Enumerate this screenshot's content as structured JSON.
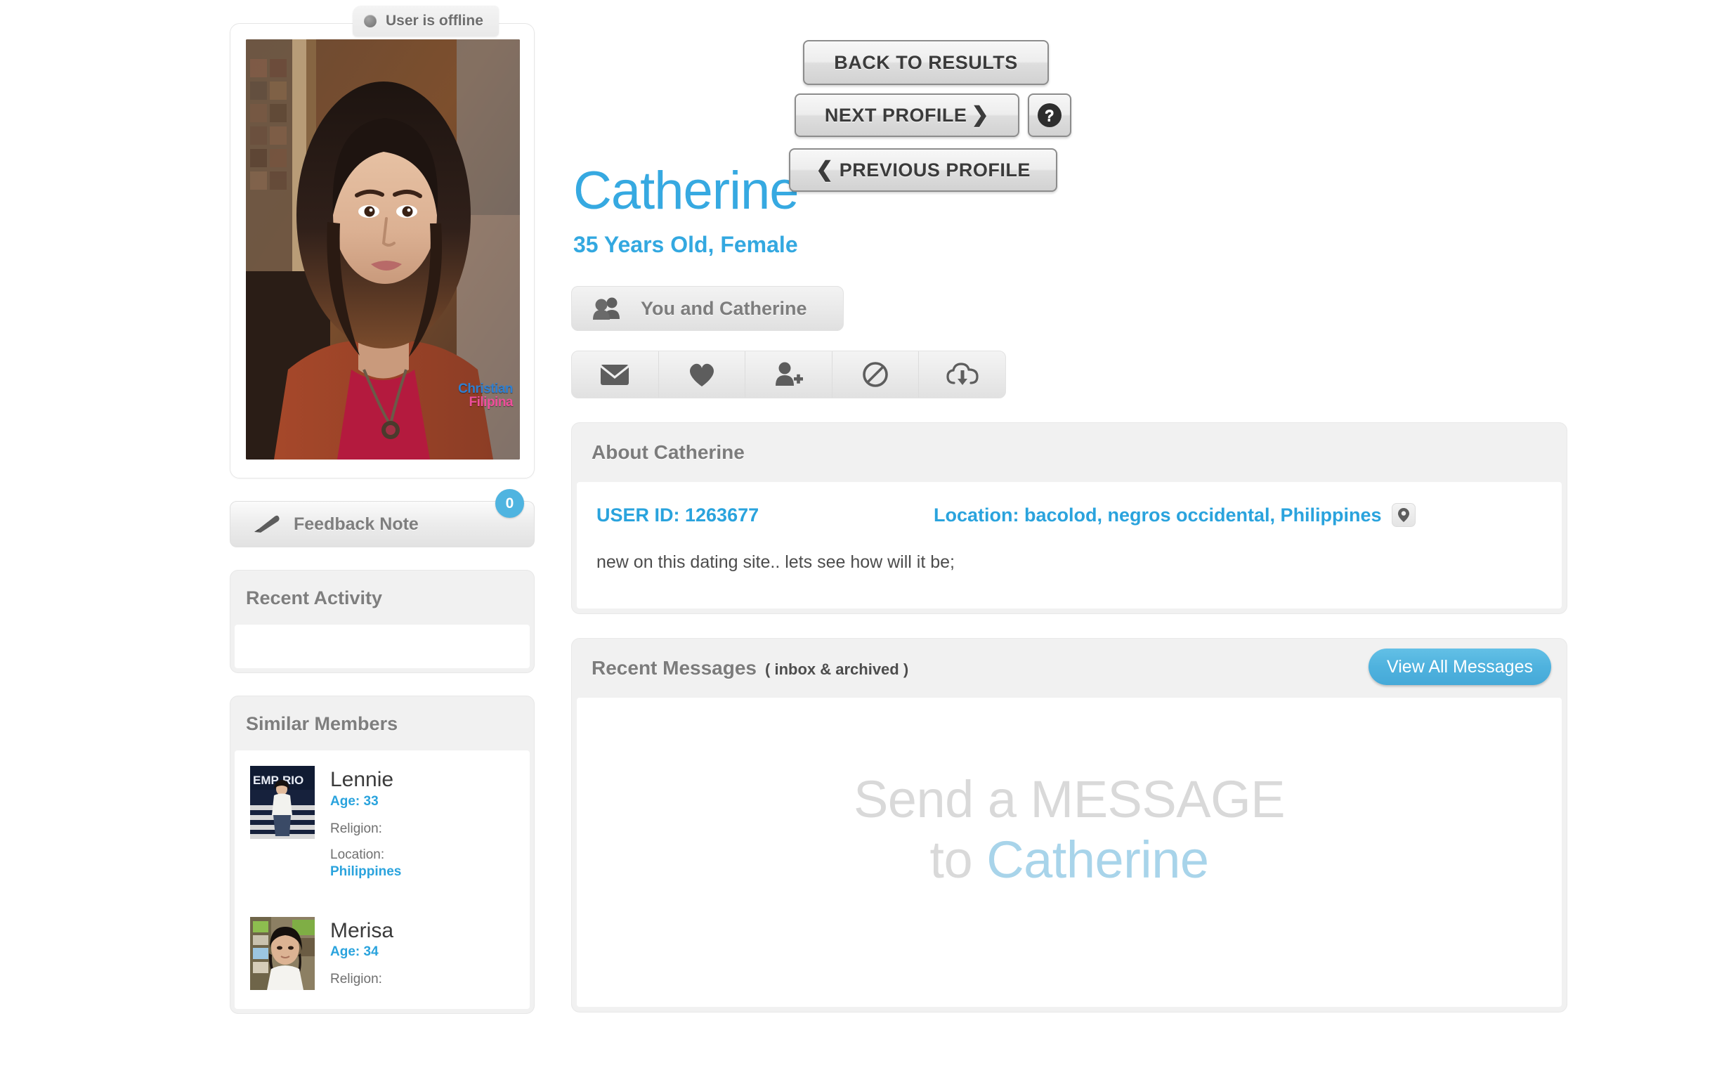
{
  "profile": {
    "status_text": "User is offline",
    "status_icon": "offline-dot-icon",
    "photo_watermark_line1": "Christian",
    "photo_watermark_line2": "Filipina",
    "name": "Catherine",
    "subtitle": "35 Years Old, Female",
    "you_and_label": "You and Catherine"
  },
  "nav": {
    "back_to_results": "BACK TO RESULTS",
    "next_profile": "NEXT PROFILE",
    "next_chevron": "❯",
    "previous_profile": "PREVIOUS PROFILE",
    "previous_chevron": "❮",
    "help": "?"
  },
  "actions": [
    {
      "name": "send-message",
      "icon": "envelope-icon"
    },
    {
      "name": "add-favorite",
      "icon": "heart-icon"
    },
    {
      "name": "add-friend",
      "icon": "person-add-icon"
    },
    {
      "name": "block-user",
      "icon": "block-icon"
    },
    {
      "name": "download-photos",
      "icon": "cloud-download-icon"
    }
  ],
  "sidebar": {
    "feedback_note": {
      "label": "Feedback Note",
      "badge": "0",
      "icon": "pen-icon"
    },
    "recent_activity": {
      "title": "Recent Activity",
      "items": []
    },
    "similar_members": {
      "title": "Similar Members",
      "members": [
        {
          "name": "Lennie",
          "age_label": "Age: 33",
          "religion_label": "Religion:",
          "religion_value": "",
          "location_label": "Location:",
          "location_value": "Philippines"
        },
        {
          "name": "Merisa",
          "age_label": "Age: 34",
          "religion_label": "Religion:",
          "religion_value": "",
          "location_label": "",
          "location_value": ""
        }
      ]
    }
  },
  "about": {
    "title": "About Catherine",
    "user_id": "USER ID: 1263677",
    "location": "Location: bacolod, negros occidental, Philippines",
    "map_icon": "map-pin-icon",
    "bio": "new on this dating site.. lets see how will it be;"
  },
  "messages": {
    "title": "Recent Messages",
    "subtitle": "( inbox & archived )",
    "view_all_label": "View All Messages",
    "empty_line1": "Send a MESSAGE",
    "empty_line2_prefix": "to ",
    "empty_line2_name": "Catherine"
  },
  "colors": {
    "accent_blue": "#33a8e0",
    "name_blue": "#36a9e1",
    "badge_blue": "#4fb4e0",
    "button_blue": "#4fb2de",
    "muted_gray": "#7e7e7e",
    "panel_gray": "#f1f1f1"
  }
}
